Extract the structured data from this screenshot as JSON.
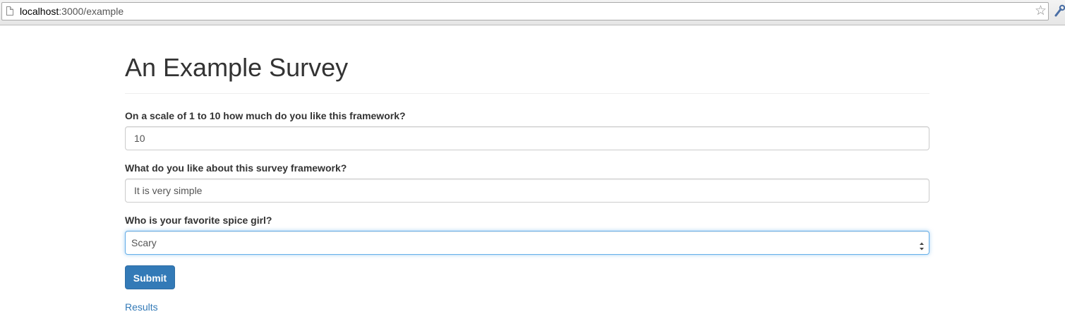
{
  "browser": {
    "url_host": "localhost",
    "url_path": ":3000/example",
    "icons": [
      "page-icon",
      "star-icon",
      "wrench-icon"
    ]
  },
  "page": {
    "title": "An Example Survey"
  },
  "questions": [
    {
      "label": "On a scale of 1 to 10 how much do you like this framework?",
      "type": "text",
      "value": "10"
    },
    {
      "label": "What do you like about this survey framework?",
      "type": "text",
      "value": "It is very simple"
    },
    {
      "label": "Who is your favorite spice girl?",
      "type": "select",
      "value": "Scary"
    }
  ],
  "actions": {
    "submit_label": "Submit",
    "results_label": "Results"
  },
  "colors": {
    "primary": "#337ab7",
    "focus_border": "#66afe9",
    "text": "#333333"
  }
}
